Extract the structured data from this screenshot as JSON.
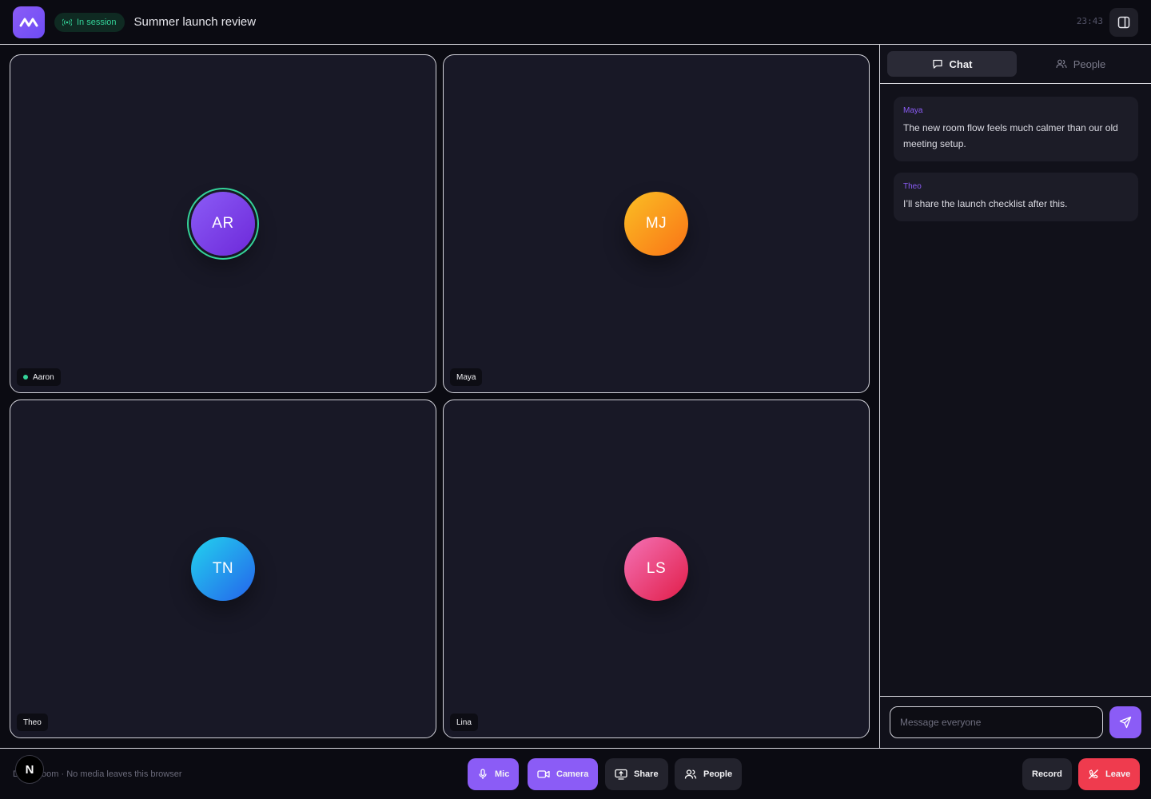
{
  "header": {
    "status_badge": "In session",
    "title": "Summer launch review",
    "clock": "23:43"
  },
  "participants": [
    {
      "name": "Aaron",
      "initials": "AR",
      "color_from": "#8b5cf6",
      "color_to": "#6d28d9",
      "speaking": true
    },
    {
      "name": "Maya",
      "initials": "MJ",
      "color_from": "#fbbf24",
      "color_to": "#f97316",
      "speaking": false
    },
    {
      "name": "Theo",
      "initials": "TN",
      "color_from": "#22d3ee",
      "color_to": "#2563eb",
      "speaking": false
    },
    {
      "name": "Lina",
      "initials": "LS",
      "color_from": "#f472b6",
      "color_to": "#e11d48",
      "speaking": false
    }
  ],
  "side_panel": {
    "tabs": [
      {
        "label": "Chat",
        "icon": "chat-bubble-icon",
        "active": true
      },
      {
        "label": "People",
        "icon": "people-icon",
        "active": false
      }
    ],
    "messages": [
      {
        "author": "Maya",
        "text": "The new room flow feels much calmer than our old meeting setup."
      },
      {
        "author": "Theo",
        "text": "I’ll share the launch checklist after this."
      }
    ],
    "composer": {
      "placeholder": "Message everyone"
    }
  },
  "footer": {
    "note": "Demo room · No media leaves this browser",
    "badge": "N",
    "controls": {
      "mic": "Mic",
      "camera": "Camera",
      "share": "Share",
      "people": "People",
      "record": "Record",
      "leave": "Leave"
    }
  },
  "colors": {
    "accent": "#8b5cf6",
    "live": "#34d399",
    "danger": "#ef3b4e"
  }
}
